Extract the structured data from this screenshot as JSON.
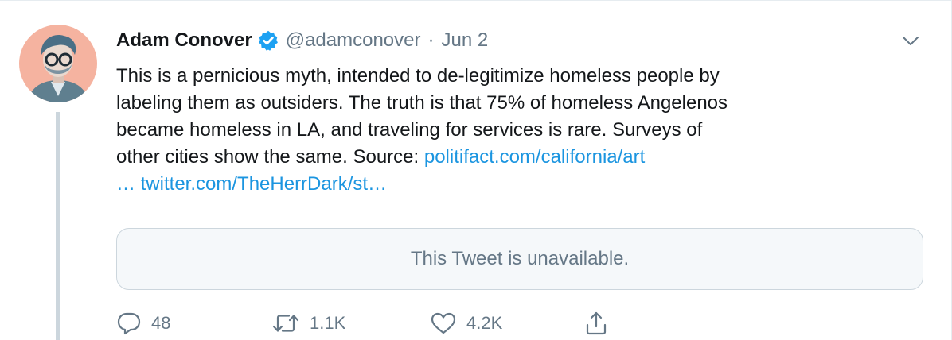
{
  "tweet": {
    "author_name": "Adam Conover",
    "handle": "@adamconover",
    "separator": "·",
    "date": "Jun 2",
    "body_lines": [
      "This is a pernicious myth, intended to de-legitimize homeless people by",
      "labeling them as outsiders. The truth is that 75% of homeless Angelenos",
      "became homeless in LA, and traveling for services is rare. Surveys of"
    ],
    "body_line4_text": "other cities show the same. Source: ",
    "link1": "politifact.com/california/art",
    "link2": "… twitter.com/TheHerrDark/st…",
    "quoted_tweet_text": "This Tweet is unavailable.",
    "reply_count": "48",
    "retweet_count": "1.1K",
    "like_count": "4.2K"
  },
  "icons": {
    "verified": "verified-badge-icon",
    "caret": "chevron-down-icon",
    "reply": "reply-bubble-icon",
    "retweet": "retweet-icon",
    "like": "heart-icon",
    "share": "share-icon"
  },
  "colors": {
    "link": "#1b95e0",
    "verified": "#1da1f2",
    "secondary_text": "#657786",
    "primary_text": "#14171a",
    "avatar_background": "#f5b3a0"
  }
}
